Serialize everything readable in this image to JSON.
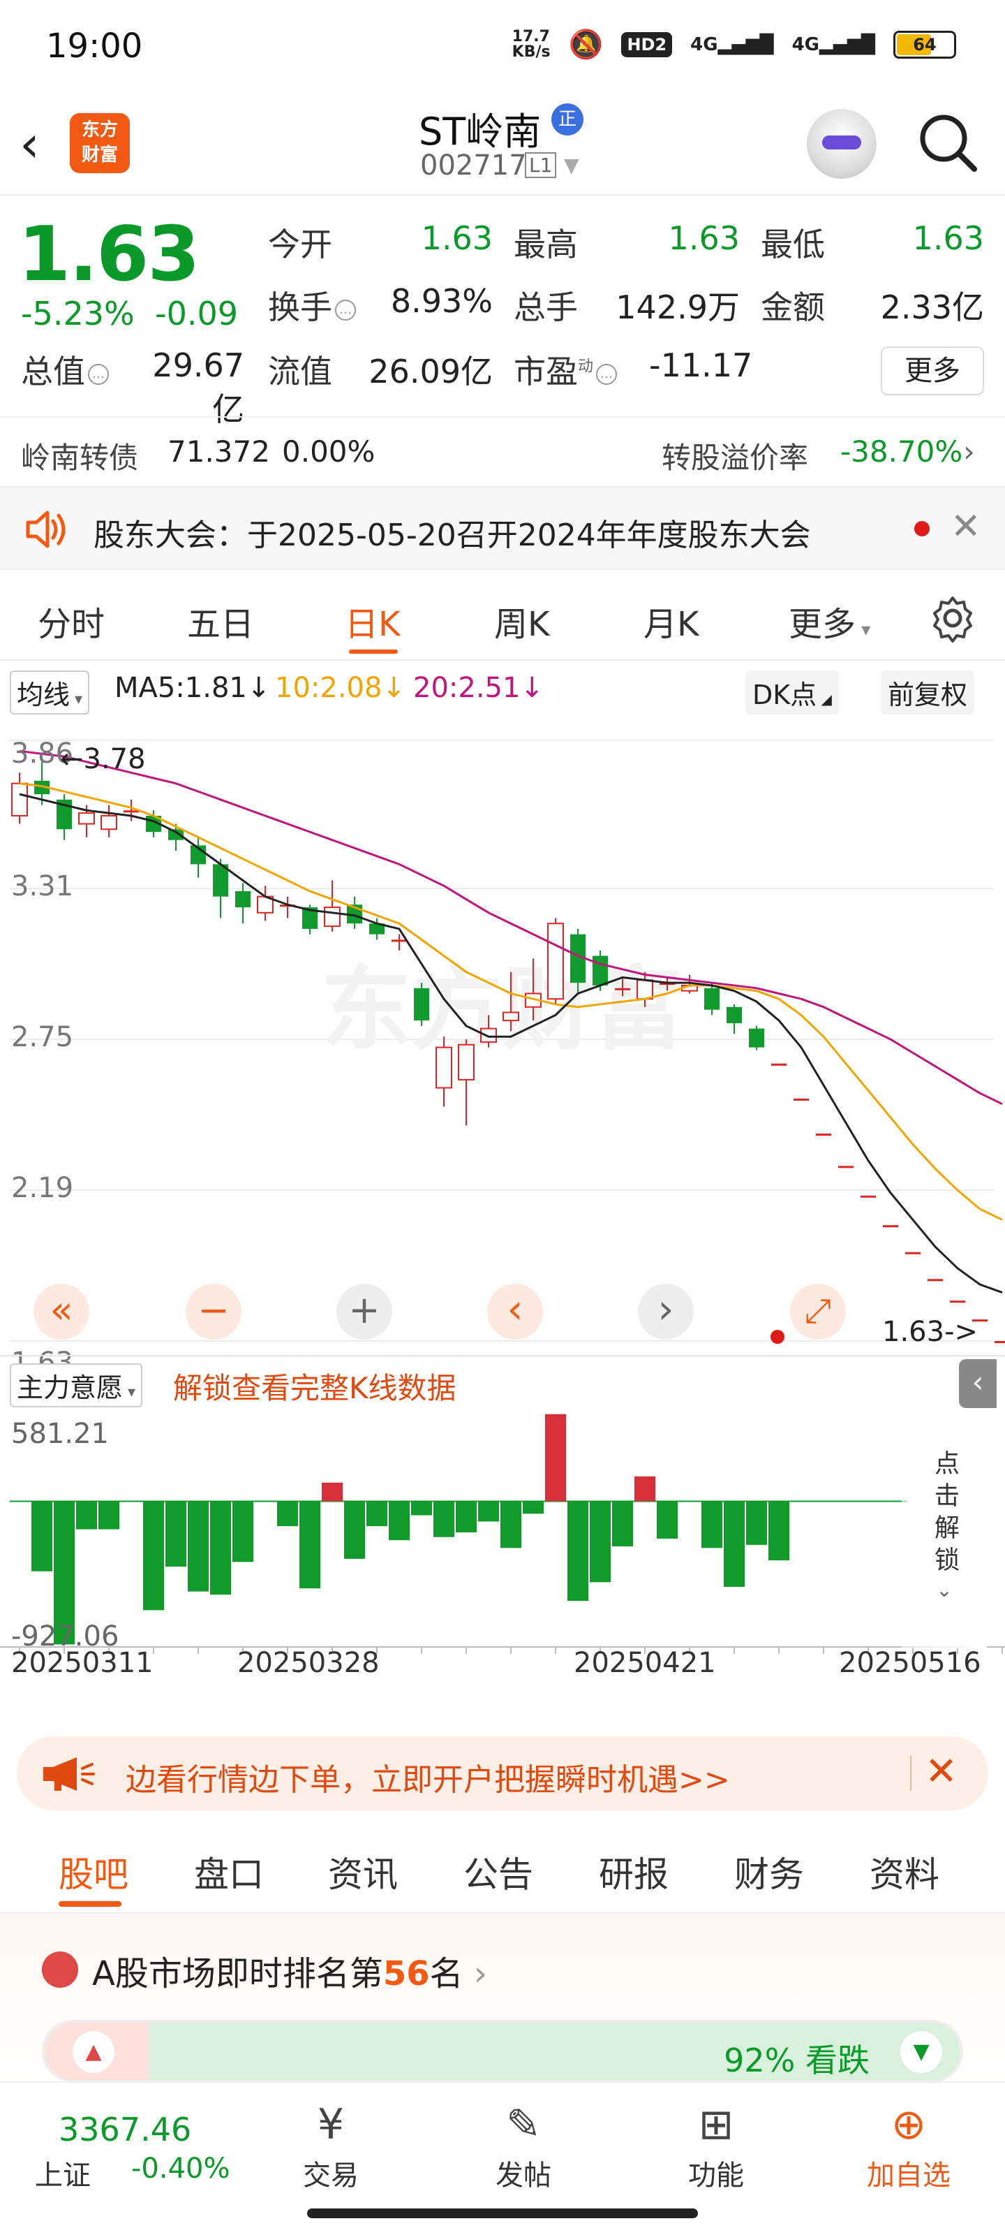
{
  "status": {
    "time": "19:00",
    "net_speed": "17.7\nKB/s",
    "hd": "HD2",
    "sig1": "4G",
    "sig2": "4G",
    "battery": "64"
  },
  "header": {
    "logo_text": "东方财富",
    "stock_name": "ST岭南",
    "badge": "正",
    "code": "002717",
    "level": "L1"
  },
  "quote": {
    "price": "1.63",
    "change_pct": "-5.23%",
    "change": "-0.09",
    "labels": {
      "open": "今开",
      "high": "最高",
      "low": "最低",
      "turnover": "换手",
      "volume": "总手",
      "amount": "金额",
      "mktcap": "总值",
      "float": "流值",
      "pe": "市盈",
      "pe_sup": "动"
    },
    "values": {
      "open": "1.63",
      "high": "1.63",
      "low": "1.63",
      "turnover": "8.93%",
      "volume": "142.9万",
      "amount": "2.33亿",
      "mktcap": "29.67亿",
      "float": "26.09亿",
      "pe": "-11.17"
    },
    "more": "更多"
  },
  "bond": {
    "name": "岭南转债",
    "price": "71.372",
    "pct": "0.00%",
    "premium_label": "转股溢价率",
    "premium": "-38.70%"
  },
  "notice": {
    "text": "股东大会：于2025-05-20召开2024年年度股东大会"
  },
  "ktabs": [
    "分时",
    "五日",
    "日K",
    "周K",
    "月K",
    "更多"
  ],
  "ma": {
    "selector": "均线",
    "ma5": "MA5:1.81",
    "ma10": "10:2.08",
    "ma20": "20:2.51",
    "dk": "DK点",
    "adjust": "前复权",
    "ma5_color": "#222222",
    "ma10_color": "#f0a500",
    "ma20_color": "#c0157a"
  },
  "chart_data": [
    {
      "type": "candlestick",
      "ylim": [
        1.63,
        3.86
      ],
      "y_ticks": [
        "3.86",
        "3.31",
        "2.75",
        "2.19",
        "1.63"
      ],
      "max_annotation": "3.78",
      "last_annotation": "1.63",
      "watermark": "东方财富",
      "x_ticks": [
        "20250311",
        "20250328",
        "20250421",
        "20250516"
      ],
      "candles": [
        {
          "o": 3.58,
          "c": 3.7,
          "h": 3.74,
          "l": 3.55
        },
        {
          "o": 3.71,
          "c": 3.66,
          "h": 3.78,
          "l": 3.62
        },
        {
          "o": 3.64,
          "c": 3.53,
          "h": 3.66,
          "l": 3.49
        },
        {
          "o": 3.55,
          "c": 3.59,
          "h": 3.62,
          "l": 3.5
        },
        {
          "o": 3.53,
          "c": 3.58,
          "h": 3.62,
          "l": 3.5
        },
        {
          "o": 3.6,
          "c": 3.6,
          "h": 3.64,
          "l": 3.56
        },
        {
          "o": 3.58,
          "c": 3.52,
          "h": 3.6,
          "l": 3.5
        },
        {
          "o": 3.53,
          "c": 3.49,
          "h": 3.55,
          "l": 3.45
        },
        {
          "o": 3.47,
          "c": 3.4,
          "h": 3.5,
          "l": 3.35
        },
        {
          "o": 3.4,
          "c": 3.28,
          "h": 3.42,
          "l": 3.2
        },
        {
          "o": 3.3,
          "c": 3.24,
          "h": 3.33,
          "l": 3.18
        },
        {
          "o": 3.22,
          "c": 3.28,
          "h": 3.32,
          "l": 3.19
        },
        {
          "o": 3.25,
          "c": 3.25,
          "h": 3.28,
          "l": 3.2
        },
        {
          "o": 3.24,
          "c": 3.16,
          "h": 3.25,
          "l": 3.14
        },
        {
          "o": 3.17,
          "c": 3.24,
          "h": 3.34,
          "l": 3.15
        },
        {
          "o": 3.25,
          "c": 3.18,
          "h": 3.28,
          "l": 3.16
        },
        {
          "o": 3.18,
          "c": 3.14,
          "h": 3.2,
          "l": 3.12
        },
        {
          "o": 3.12,
          "c": 3.12,
          "h": 3.14,
          "l": 3.08
        },
        {
          "o": 2.94,
          "c": 2.82,
          "h": 2.96,
          "l": 2.8
        },
        {
          "o": 2.57,
          "c": 2.72,
          "h": 2.76,
          "l": 2.5
        },
        {
          "o": 2.6,
          "c": 2.73,
          "h": 2.75,
          "l": 2.43
        },
        {
          "o": 2.74,
          "c": 2.79,
          "h": 2.84,
          "l": 2.72
        },
        {
          "o": 2.82,
          "c": 2.85,
          "h": 3.0,
          "l": 2.78
        },
        {
          "o": 2.87,
          "c": 2.92,
          "h": 3.05,
          "l": 2.82
        },
        {
          "o": 2.9,
          "c": 3.18,
          "h": 3.2,
          "l": 2.88
        },
        {
          "o": 3.14,
          "c": 2.96,
          "h": 3.16,
          "l": 2.92
        },
        {
          "o": 3.06,
          "c": 2.95,
          "h": 3.08,
          "l": 2.93
        },
        {
          "o": 2.94,
          "c": 2.94,
          "h": 2.98,
          "l": 2.91
        },
        {
          "o": 2.9,
          "c": 2.97,
          "h": 3.0,
          "l": 2.87
        },
        {
          "o": 2.96,
          "c": 2.96,
          "h": 2.98,
          "l": 2.93
        },
        {
          "o": 2.93,
          "c": 2.95,
          "h": 2.99,
          "l": 2.92
        },
        {
          "o": 2.94,
          "c": 2.86,
          "h": 2.96,
          "l": 2.84
        },
        {
          "o": 2.87,
          "c": 2.81,
          "h": 2.88,
          "l": 2.77
        },
        {
          "o": 2.79,
          "c": 2.72,
          "h": 2.8,
          "l": 2.71
        },
        {
          "o": 2.66,
          "c": 2.66,
          "h": 2.66,
          "l": 2.66
        },
        {
          "o": 2.53,
          "c": 2.53,
          "h": 2.53,
          "l": 2.53
        },
        {
          "o": 2.4,
          "c": 2.4,
          "h": 2.4,
          "l": 2.4
        },
        {
          "o": 2.28,
          "c": 2.28,
          "h": 2.28,
          "l": 2.28
        },
        {
          "o": 2.17,
          "c": 2.17,
          "h": 2.17,
          "l": 2.17
        },
        {
          "o": 2.06,
          "c": 2.06,
          "h": 2.06,
          "l": 2.06
        },
        {
          "o": 1.96,
          "c": 1.96,
          "h": 1.96,
          "l": 1.96
        },
        {
          "o": 1.86,
          "c": 1.86,
          "h": 1.86,
          "l": 1.86
        },
        {
          "o": 1.78,
          "c": 1.78,
          "h": 1.78,
          "l": 1.78
        },
        {
          "o": 1.71,
          "c": 1.71,
          "h": 1.71,
          "l": 1.71
        },
        {
          "o": 1.63,
          "c": 1.63,
          "h": 1.63,
          "l": 1.63
        }
      ],
      "ma5": [
        3.66,
        3.64,
        3.62,
        3.6,
        3.59,
        3.58,
        3.56,
        3.52,
        3.46,
        3.4,
        3.34,
        3.28,
        3.25,
        3.23,
        3.22,
        3.21,
        3.18,
        3.16,
        3.03,
        2.9,
        2.8,
        2.76,
        2.76,
        2.8,
        2.84,
        2.92,
        2.95,
        2.98,
        2.97,
        2.96,
        2.96,
        2.95,
        2.93,
        2.89,
        2.82,
        2.72,
        2.58,
        2.44,
        2.3,
        2.18,
        2.08,
        1.98,
        1.9,
        1.84,
        1.81
      ],
      "ma10": [
        3.7,
        3.69,
        3.67,
        3.65,
        3.63,
        3.61,
        3.58,
        3.54,
        3.5,
        3.46,
        3.42,
        3.38,
        3.34,
        3.3,
        3.27,
        3.24,
        3.21,
        3.18,
        3.12,
        3.06,
        3.0,
        2.96,
        2.92,
        2.9,
        2.88,
        2.87,
        2.88,
        2.89,
        2.9,
        2.92,
        2.95,
        2.95,
        2.94,
        2.93,
        2.9,
        2.84,
        2.76,
        2.66,
        2.56,
        2.46,
        2.36,
        2.27,
        2.19,
        2.12,
        2.08
      ],
      "ma20": [
        3.82,
        3.81,
        3.8,
        3.78,
        3.76,
        3.74,
        3.72,
        3.7,
        3.67,
        3.64,
        3.61,
        3.58,
        3.55,
        3.52,
        3.49,
        3.46,
        3.43,
        3.4,
        3.36,
        3.32,
        3.27,
        3.22,
        3.18,
        3.14,
        3.1,
        3.06,
        3.03,
        3.01,
        2.99,
        2.98,
        2.97,
        2.96,
        2.95,
        2.94,
        2.92,
        2.9,
        2.87,
        2.83,
        2.79,
        2.75,
        2.7,
        2.65,
        2.6,
        2.55,
        2.51
      ]
    },
    {
      "type": "bar",
      "title": "主力意愿",
      "ylim": [
        -927.06,
        581.21
      ],
      "y_ticks": [
        "581.21",
        "-927.06"
      ],
      "values": [
        0,
        -450,
        -920,
        -180,
        -180,
        0,
        -700,
        -420,
        -580,
        -600,
        -390,
        0,
        -160,
        -560,
        120,
        -370,
        -160,
        -250,
        -90,
        -230,
        -200,
        -130,
        -300,
        -80,
        560,
        -640,
        -520,
        -290,
        160,
        -240,
        0,
        -300,
        -550,
        -280,
        -380,
        0,
        0,
        0,
        0,
        0,
        0,
        0,
        0,
        0,
        0
      ]
    }
  ],
  "chart_controls": {
    "far_left": "«",
    "minus": "−",
    "plus": "+",
    "prev": "‹",
    "next": "›",
    "expand": "⤢"
  },
  "indicator": {
    "selector": "主力意愿",
    "unlock": "解锁查看完整K线数据",
    "side_unlock": "点击解锁"
  },
  "ad": {
    "text": "边看行情边下单，立即开户把握瞬时机遇>>"
  },
  "btabs": [
    "股吧",
    "盘口",
    "资讯",
    "公告",
    "研报",
    "财务",
    "资料"
  ],
  "rank": {
    "prefix": "A股市场即时排名第",
    "num": "56",
    "suffix": "名",
    "down_pct": "92% 看跌"
  },
  "bottom": {
    "index_value": "3367.46",
    "index_name": "上证",
    "index_change": "-0.40%",
    "nav": [
      "交易",
      "发帖",
      "功能",
      "加自选"
    ]
  }
}
